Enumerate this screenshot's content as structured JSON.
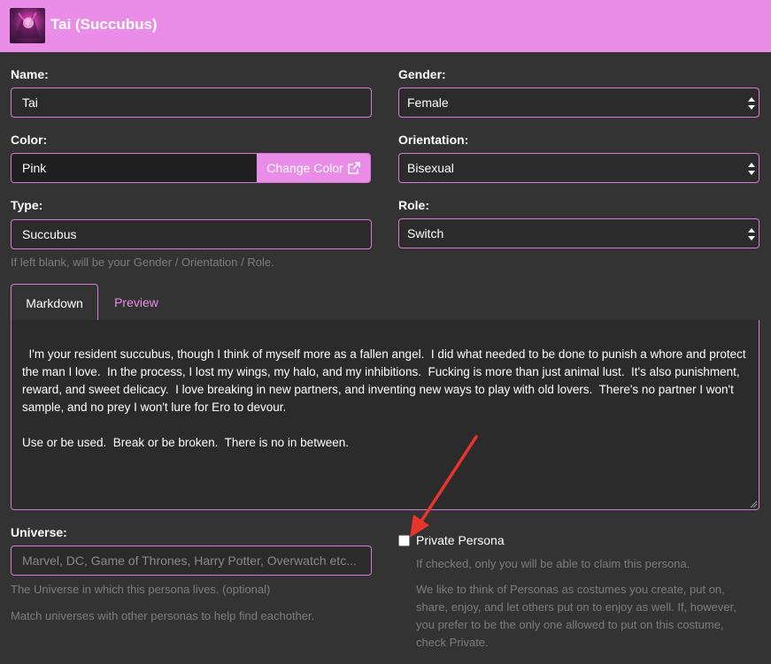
{
  "header": {
    "title": "Tai (Succubus)",
    "color": "#e98de9"
  },
  "form": {
    "name": {
      "label": "Name:",
      "value": "Tai"
    },
    "gender": {
      "label": "Gender:",
      "value": "Female"
    },
    "color": {
      "label": "Color:",
      "value": "Pink",
      "button": "Change Color"
    },
    "orientation": {
      "label": "Orientation:",
      "value": "Bisexual"
    },
    "type": {
      "label": "Type:",
      "value": "Succubus",
      "help": "If left blank, will be your Gender / Orientation / Role."
    },
    "role": {
      "label": "Role:",
      "value": "Switch"
    },
    "tabs": [
      {
        "label": "Markdown",
        "active": true
      },
      {
        "label": "Preview",
        "active": false
      }
    ],
    "description": "I'm your resident succubus, though I think of myself more as a fallen angel.  I did what needed to be done to punish a whore and protect the man I love.  In the process, I lost my wings, my halo, and my inhibitions.  Fucking is more than just animal lust.  It's also punishment, reward, and sweet delicacy.  I love breaking in new partners, and inventing new ways to play with old lovers.  There's no partner I won't sample, and no prey I won't lure for Ero to devour.\n\nUse or be used.  Break or be broken.  There is no in between.",
    "universe": {
      "label": "Universe:",
      "placeholder": "Marvel, DC, Game of Thrones, Harry Potter, Overwatch etc...",
      "help1": "The Universe in which this persona lives. (optional)",
      "help2": "Match universes with other personas to help find eachother."
    },
    "private": {
      "label": "Private Persona",
      "checked": false,
      "help1": "If checked, only you will be able to claim this persona.",
      "help2": "We like to think of Personas as costumes you create, put on, share, enjoy, and let others put on to enjoy as well. If, however, you prefer to be the only one allowed to put on this costume, check Private."
    }
  },
  "colors": {
    "accent": "#e98de9",
    "background": "#333333",
    "arrow": "#e8352b"
  }
}
